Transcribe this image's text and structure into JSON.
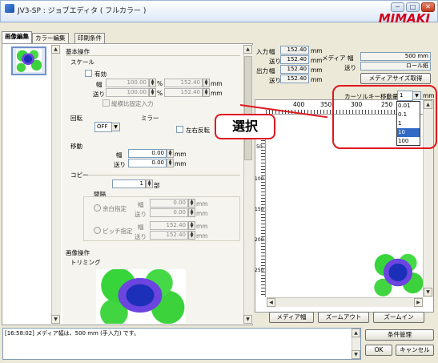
{
  "window": {
    "title": "JV3-SP : ジョブエディタ ( フルカラー )",
    "logo_text": "MIMAKI",
    "min_glyph": "─",
    "max_glyph": "□",
    "close_glyph": "✕"
  },
  "tabs": [
    {
      "label": "画像編集"
    },
    {
      "label": "カラー編集"
    },
    {
      "label": "印刷条件"
    }
  ],
  "left_panel": {
    "basic_ops_title": "基本操作",
    "scale": {
      "title": "スケール",
      "enabled_label": "有効",
      "width_label": "幅",
      "width_percent": "100.00",
      "width_mm": "152.40",
      "feed_label": "送り",
      "feed_percent": "100.00",
      "feed_mm": "152.40",
      "percent_unit": "%",
      "mm_unit": "mm",
      "aspect_label": "縦横比固定入力"
    },
    "rotate": {
      "title": "回転",
      "value": "OFF"
    },
    "mirror": {
      "title": "ミラー",
      "flip_label": "左右反転"
    },
    "move": {
      "title": "移動",
      "width_label": "幅",
      "width_value": "0.00",
      "feed_label": "送り",
      "feed_value": "0.00",
      "mm_unit": "mm"
    },
    "copy": {
      "title": "コピー",
      "count": "1",
      "count_unit": "部",
      "spacing_title": "間隔",
      "margin_label": "余白指定",
      "pitch_label": "ピッチ指定",
      "width_label": "幅",
      "feed_label": "送り",
      "margin_width": "0.00",
      "margin_feed": "0.00",
      "pitch_width": "152.40",
      "pitch_feed": "152.40",
      "mm_unit": "mm"
    },
    "image_ops_title": "画像操作",
    "trimming_title": "トリミング"
  },
  "info": {
    "input_label": "入力",
    "output_label": "出力",
    "width_label": "幅",
    "feed_label": "送り",
    "input_width": "152.40",
    "input_feed": "152.40",
    "output_width": "152.40",
    "output_feed": "152.40",
    "mm_unit": "mm",
    "media_title": "メディア",
    "media_width_label": "幅",
    "media_width_value": "500 mm",
    "media_feed_label": "送り",
    "media_feed_value": "ロール紙",
    "media_size_button": "メディアサイズ取得"
  },
  "cursor": {
    "label": "カーソルキー移動量",
    "value": "1",
    "unit": "mm",
    "options": [
      "0.01",
      "0.1",
      "1",
      "10",
      "100"
    ],
    "selected_index": 3
  },
  "ruler": {
    "h_labels": [
      "400",
      "350",
      "300",
      "250"
    ],
    "v_labels": [
      "50",
      "100",
      "150",
      "200",
      "250"
    ]
  },
  "callout": {
    "text": "選択"
  },
  "bottom_buttons": {
    "media_width": "メディア幅",
    "zoom_out": "ズームアウト",
    "zoom_in": "ズームイン"
  },
  "log": {
    "message": "[16:58:02] メディア幅は、500 mm (手入力) です。"
  },
  "actions": {
    "condition_manage": "条件管理",
    "ok": "OK",
    "cancel": "キャンセル"
  }
}
